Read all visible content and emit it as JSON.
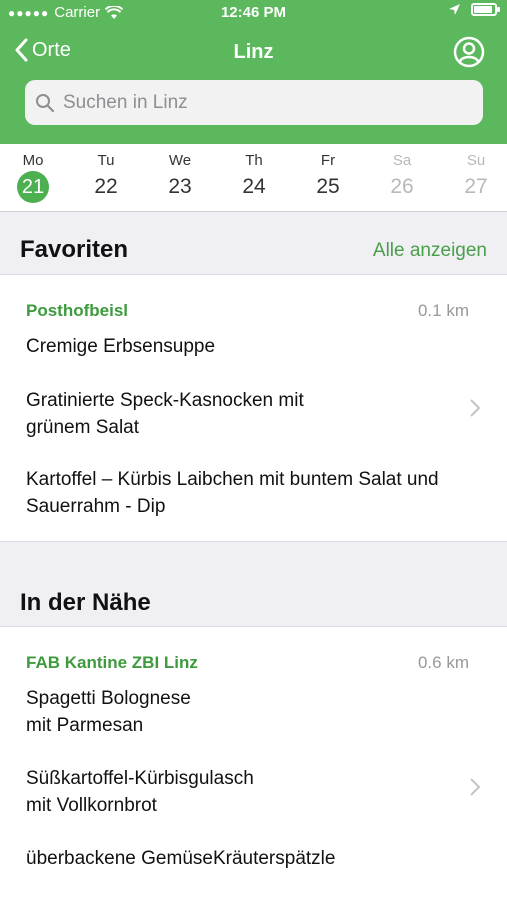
{
  "status_bar": {
    "carrier": "Carrier",
    "time": "12:46 PM",
    "battery_level": 0.9
  },
  "nav": {
    "back_label": "Orte",
    "title": "Linz"
  },
  "search": {
    "placeholder": "Suchen in Linz",
    "value": ""
  },
  "days": [
    {
      "name": "Mo",
      "date": "21",
      "state": "selected"
    },
    {
      "name": "Tu",
      "date": "22",
      "state": "enabled"
    },
    {
      "name": "We",
      "date": "23",
      "state": "enabled"
    },
    {
      "name": "Th",
      "date": "24",
      "state": "enabled"
    },
    {
      "name": "Fr",
      "date": "25",
      "state": "enabled"
    },
    {
      "name": "Sa",
      "date": "26",
      "state": "disabled"
    },
    {
      "name": "Su",
      "date": "27",
      "state": "disabled"
    }
  ],
  "favorites": {
    "title": "Favoriten",
    "show_all_label": "Alle anzeigen",
    "restaurant": {
      "name": "Posthofbeisl",
      "distance": "0.1 km",
      "dishes": [
        "Cremige Erbsensuppe",
        "Gratinierte Speck-Kasnocken mit grünem Salat",
        "Kartoffel – Kürbis Laibchen mit buntem Salat und Sauerrahm - Dip"
      ]
    }
  },
  "nearby": {
    "title": "In der Nähe",
    "restaurant": {
      "name": "FAB Kantine ZBI Linz",
      "distance": "0.6 km",
      "dishes": [
        "Spagetti Bolognese\nmit Parmesan",
        "Süßkartoffel-Kürbisgulasch\nmit Vollkornbrot",
        "überbackene GemüseKräuterspätzle"
      ]
    }
  },
  "colors": {
    "header": "#5cb85c",
    "accent": "#4a9f4a",
    "restaurant_name": "#3d9a3d"
  }
}
